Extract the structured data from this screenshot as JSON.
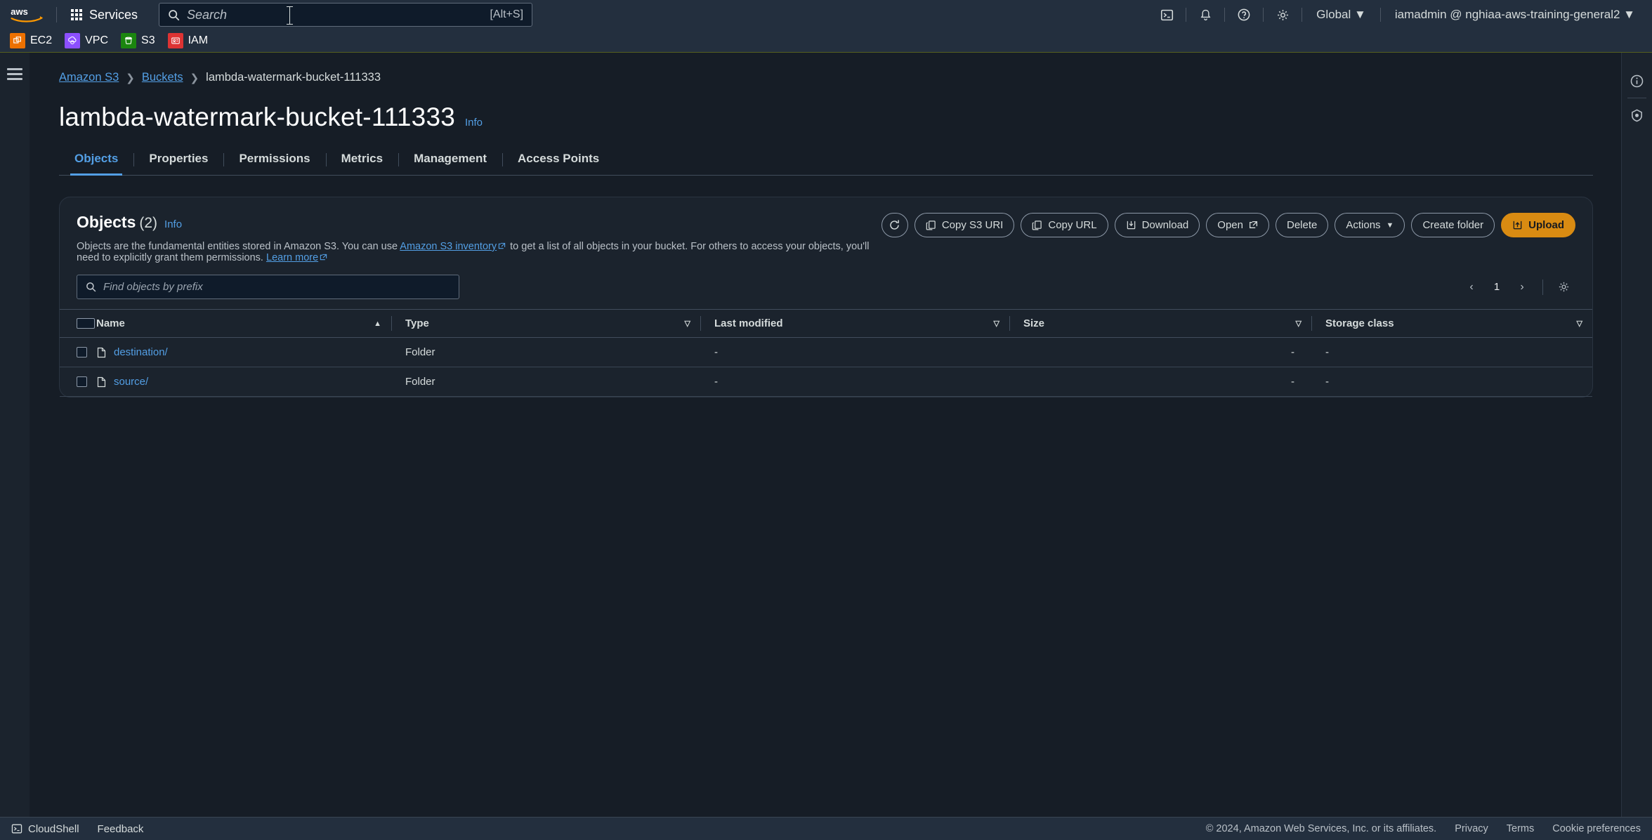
{
  "topnav": {
    "logo_alt": "aws",
    "services_label": "Services",
    "search_placeholder": "Search",
    "search_value": "",
    "search_shortcut": "[Alt+S]",
    "region_label": "Global",
    "account_label": "iamadmin @ nghiaa-aws-training-general2",
    "icons": [
      "cloudshell-icon",
      "bell-icon",
      "help-icon",
      "settings-icon"
    ]
  },
  "shortcuts": [
    {
      "label": "EC2",
      "color": "#ed7100",
      "icon": "ec2-icon"
    },
    {
      "label": "VPC",
      "color": "#8c4fff",
      "icon": "vpc-icon"
    },
    {
      "label": "S3",
      "color": "#1b860f",
      "icon": "s3-icon"
    },
    {
      "label": "IAM",
      "color": "#dd3333",
      "icon": "iam-icon"
    }
  ],
  "breadcrumb": [
    {
      "label": "Amazon S3",
      "link": true
    },
    {
      "label": "Buckets",
      "link": true
    },
    {
      "label": "lambda-watermark-bucket-111333",
      "link": false
    }
  ],
  "page": {
    "title": "lambda-watermark-bucket-111333",
    "info_label": "Info"
  },
  "tabs": [
    {
      "label": "Objects",
      "active": true
    },
    {
      "label": "Properties",
      "active": false
    },
    {
      "label": "Permissions",
      "active": false
    },
    {
      "label": "Metrics",
      "active": false
    },
    {
      "label": "Management",
      "active": false
    },
    {
      "label": "Access Points",
      "active": false
    }
  ],
  "objects_panel": {
    "heading": "Objects",
    "count": "(2)",
    "info_label": "Info",
    "description_part1": "Objects are the fundamental entities stored in Amazon S3. You can use ",
    "description_link1": "Amazon S3 inventory",
    "description_part2": " to get a list of all objects in your bucket. For others to access your objects, you'll need to explicitly grant them permissions. ",
    "description_link2": "Learn more",
    "buttons": {
      "refresh": "",
      "copy_s3_uri": "Copy S3 URI",
      "copy_url": "Copy URL",
      "download": "Download",
      "open": "Open",
      "delete": "Delete",
      "actions": "Actions",
      "create_folder": "Create folder",
      "upload": "Upload"
    },
    "filter_placeholder": "Find objects by prefix",
    "filter_value": "",
    "pagination": {
      "page": "1"
    },
    "columns": [
      "Name",
      "Type",
      "Last modified",
      "Size",
      "Storage class"
    ],
    "rows": [
      {
        "name": "destination/",
        "type": "Folder",
        "last_modified": "-",
        "size": "-",
        "storage_class": "-"
      },
      {
        "name": "source/",
        "type": "Folder",
        "last_modified": "-",
        "size": "-",
        "storage_class": "-"
      }
    ]
  },
  "footer": {
    "cloudshell": "CloudShell",
    "feedback": "Feedback",
    "copyright": "© 2024, Amazon Web Services, Inc. or its affiliates.",
    "privacy": "Privacy",
    "terms": "Terms",
    "cookie": "Cookie preferences"
  },
  "colors": {
    "accent_blue": "#539fe5",
    "upload_orange": "#d98b12",
    "nav_bg": "#232f3e",
    "page_bg": "#161d26"
  }
}
